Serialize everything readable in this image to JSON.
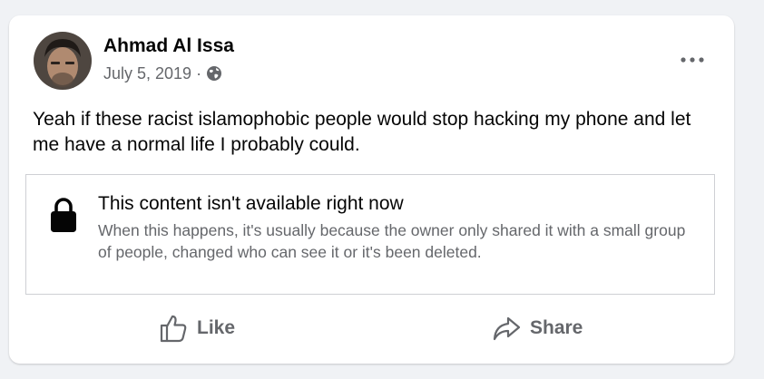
{
  "post": {
    "author": "Ahmad Al Issa",
    "date": "July 5, 2019",
    "separator": "·",
    "privacy_icon": "globe-icon",
    "text": "Yeah if these racist islamophobic people would stop hacking my phone and let me have a normal life I probably could."
  },
  "shared_content": {
    "icon": "lock-icon",
    "title": "This content isn't available right now",
    "description": "When this happens, it's usually because the owner only shared it with a small group of people, changed who can see it or it's been deleted."
  },
  "actions": {
    "like_label": "Like",
    "share_label": "Share"
  }
}
